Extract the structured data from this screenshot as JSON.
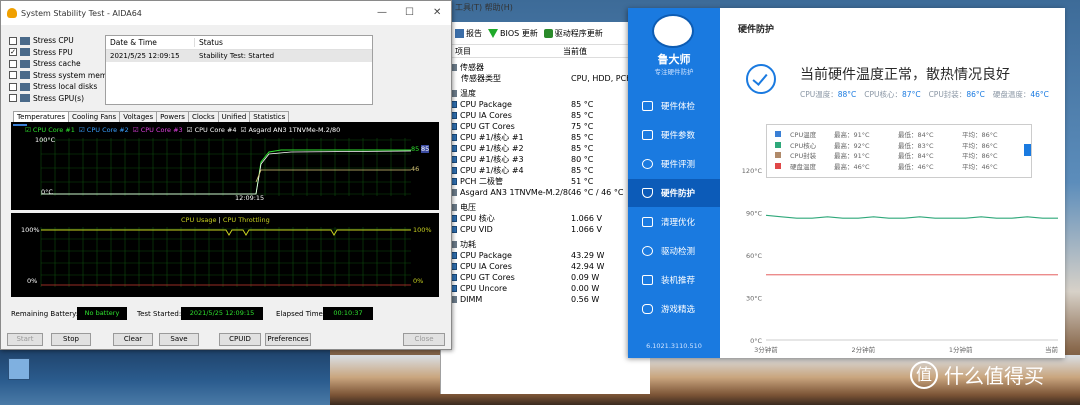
{
  "aida_main": {
    "menu": "工具(T)   帮助(H)",
    "toolbar": [
      {
        "icon": "report-icon",
        "label": "报告"
      },
      {
        "icon": "bios-update-icon",
        "label": "BIOS 更新"
      },
      {
        "icon": "driver-update-icon",
        "label": "驱动程序更新"
      }
    ],
    "columns": {
      "item": "项目",
      "value": "当前值"
    },
    "sections": [
      {
        "title": "传感器",
        "rows": [
          {
            "k": "传感器类型",
            "v": "CPU, HDD, PCH, SNB"
          }
        ]
      },
      {
        "title": "温度",
        "rows": [
          {
            "k": "CPU Package",
            "v": "85 °C"
          },
          {
            "k": "CPU IA Cores",
            "v": "85 °C"
          },
          {
            "k": "CPU GT Cores",
            "v": "75 °C"
          },
          {
            "k": "CPU #1/核心 #1",
            "v": "85 °C"
          },
          {
            "k": "CPU #1/核心 #2",
            "v": "85 °C"
          },
          {
            "k": "CPU #1/核心 #3",
            "v": "80 °C"
          },
          {
            "k": "CPU #1/核心 #4",
            "v": "85 °C"
          },
          {
            "k": "PCH 二极管",
            "v": "51 °C"
          },
          {
            "k": "Asgard AN3 1TNVMe-M.2/80",
            "v": "46 °C / 46 °C"
          }
        ]
      },
      {
        "title": "电压",
        "rows": [
          {
            "k": "CPU 核心",
            "v": "1.066 V"
          },
          {
            "k": "CPU VID",
            "v": "1.066 V"
          }
        ]
      },
      {
        "title": "功耗",
        "rows": [
          {
            "k": "CPU Package",
            "v": "43.29 W"
          },
          {
            "k": "CPU IA Cores",
            "v": "42.94 W"
          },
          {
            "k": "CPU GT Cores",
            "v": "0.09 W"
          },
          {
            "k": "CPU Uncore",
            "v": "0.00 W"
          },
          {
            "k": "DIMM",
            "v": "0.56 W"
          }
        ]
      }
    ]
  },
  "sst": {
    "title": "System Stability Test - AIDA64",
    "checks": [
      {
        "label": "Stress CPU",
        "checked": false
      },
      {
        "label": "Stress FPU",
        "checked": true
      },
      {
        "label": "Stress cache",
        "checked": false
      },
      {
        "label": "Stress system memory",
        "checked": false
      },
      {
        "label": "Stress local disks",
        "checked": false
      },
      {
        "label": "Stress GPU(s)",
        "checked": false
      }
    ],
    "log": {
      "col1": "Date & Time",
      "col2": "Status",
      "date": "2021/5/25 12:09:15",
      "status": "Stability Test: Started"
    },
    "tabs": [
      "Temperatures",
      "Cooling Fans",
      "Voltages",
      "Powers",
      "Clocks",
      "Unified",
      "Statistics"
    ],
    "temp_legend": [
      {
        "label": "CPU Core #1",
        "color": "#2ee02e"
      },
      {
        "label": "CPU Core #2",
        "color": "#3aa0ff"
      },
      {
        "label": "CPU Core #3",
        "color": "#e040e0"
      },
      {
        "label": "CPU Core #4",
        "color": "#ffffff"
      },
      {
        "label": "Asgard AN3 1TNVMe-M.2/80",
        "color": "#ffffff"
      }
    ],
    "temp_axis": {
      "top": "100°C",
      "bottom": "0°C",
      "time": "12:09:15",
      "r1": "85",
      "r2": "85",
      "r3": "46"
    },
    "usage_legend": {
      "a": "CPU Usage",
      "sep": "|",
      "b": "CPU Throttling"
    },
    "usage_axis": {
      "top_l": "100%",
      "bottom_l": "0%",
      "top_r": "100%",
      "bottom_r": "0%"
    },
    "remaining_battery_label": "Remaining Battery:",
    "remaining_battery_value": "No battery",
    "test_started_label": "Test Started:",
    "test_started_value": "2021/5/25 12:09:15",
    "elapsed_label": "Elapsed Time:",
    "elapsed_value": "00:10:37",
    "buttons": {
      "start": "Start",
      "stop": "Stop",
      "clear": "Clear",
      "save": "Save",
      "cpuid": "CPUID",
      "preferences": "Preferences",
      "close": "Close"
    }
  },
  "lds": {
    "brand": "鲁大师",
    "slogan": "专注硬件防护",
    "page_title": "硬件防护",
    "nav": [
      "硬件体检",
      "硬件参数",
      "硬件评测",
      "硬件防护",
      "清理优化",
      "驱动检测",
      "装机推荐",
      "游戏精选"
    ],
    "active_nav": 3,
    "version": "6.1021.3110.510",
    "headline": "当前硬件温度正常，散热情况良好",
    "stats": [
      {
        "label": "CPU温度：",
        "value": "88°C"
      },
      {
        "label": "CPU核心：",
        "value": "87°C"
      },
      {
        "label": "CPU封装：",
        "value": "86°C"
      },
      {
        "label": "硬盘温度：",
        "value": "46°C"
      }
    ],
    "legend": [
      {
        "name": "CPU温度",
        "max": "最高：91°C",
        "min": "最低：84°C",
        "avg": "平均：86°C",
        "color": "#3a7fd5"
      },
      {
        "name": "CPU核心",
        "max": "最高：92°C",
        "min": "最低：83°C",
        "avg": "平均：86°C",
        "color": "#2fa87a"
      },
      {
        "name": "CPU封装",
        "max": "最高：91°C",
        "min": "最低：84°C",
        "avg": "平均：86°C",
        "color": "#b08a6a"
      },
      {
        "name": "硬盘温度",
        "max": "最高：46°C",
        "min": "最低：46°C",
        "avg": "平均：46°C",
        "color": "#e04848"
      }
    ],
    "chart_data": {
      "type": "line",
      "y_ticks": [
        "120°C",
        "90°C",
        "60°C",
        "30°C",
        "0°C"
      ],
      "x_ticks": [
        "3分钟前",
        "2分钟前",
        "1分钟前",
        "当前"
      ],
      "ylim": [
        0,
        120
      ],
      "series": [
        {
          "name": "CPU核心",
          "values": [
            88,
            87,
            86,
            86,
            87,
            86,
            86,
            87,
            86,
            86,
            87,
            86,
            86,
            86,
            87,
            86,
            86,
            87,
            86,
            86
          ]
        },
        {
          "name": "硬盘温度",
          "values": [
            46,
            46,
            46,
            46,
            46,
            46,
            46,
            46,
            46,
            46,
            46,
            46,
            46,
            46,
            46,
            46,
            46,
            46,
            46,
            46
          ]
        }
      ]
    }
  },
  "watermark": {
    "mark": "值",
    "text": "什么值得买"
  }
}
